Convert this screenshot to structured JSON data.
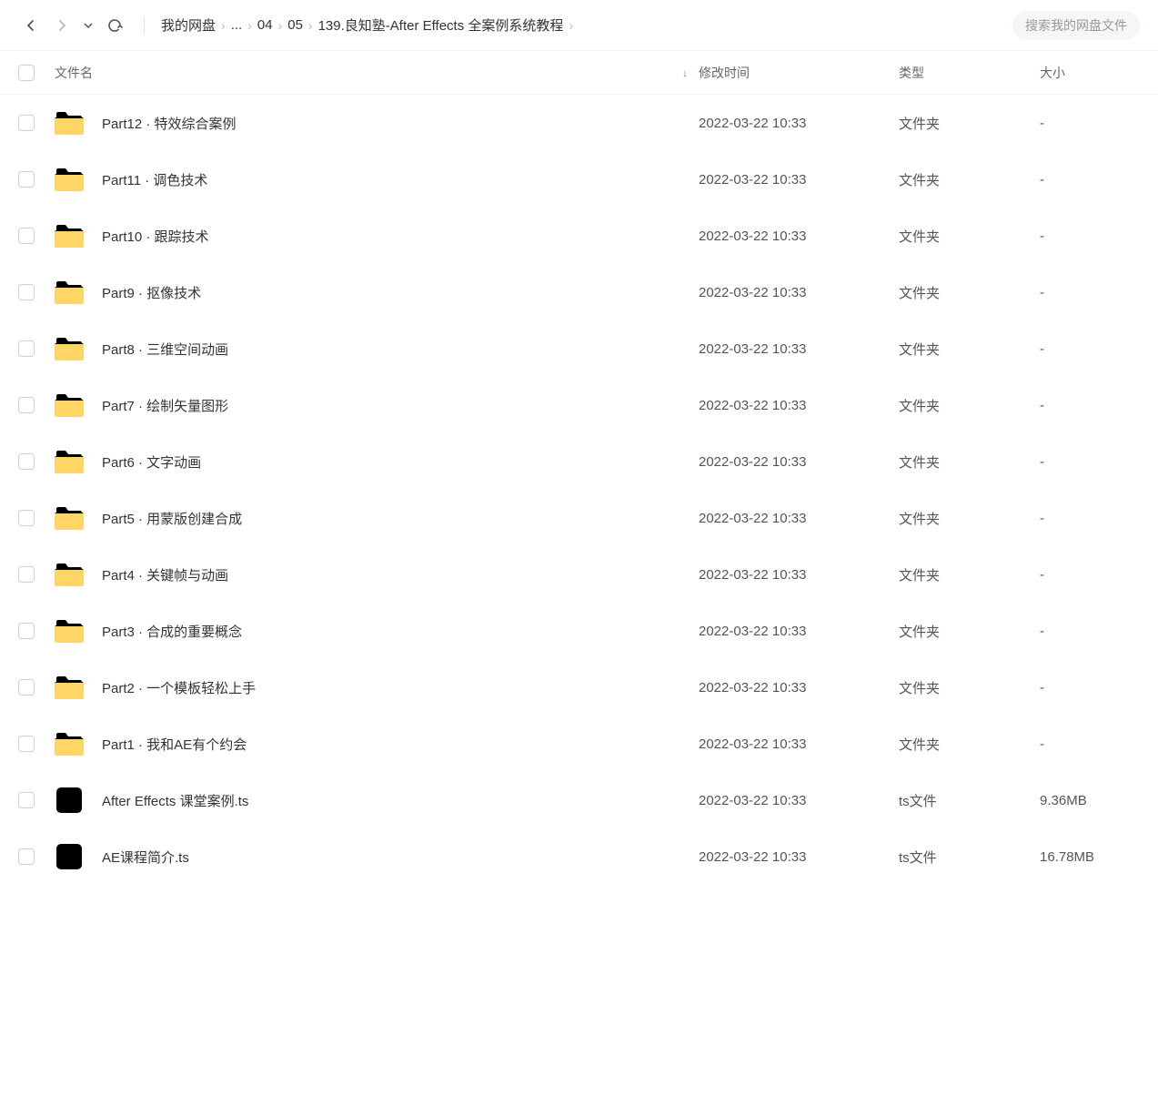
{
  "toolbar": {
    "breadcrumb": [
      "我的网盘",
      "...",
      "04",
      "05",
      "139.良知塾-After Effects 全案例系统教程"
    ]
  },
  "search": {
    "placeholder": "搜索我的网盘文件"
  },
  "columns": {
    "name": "文件名",
    "date": "修改时间",
    "type": "类型",
    "size": "大小"
  },
  "rows": [
    {
      "icon": "folder",
      "name": "Part12 · 特效综合案例",
      "date": "2022-03-22 10:33",
      "type": "文件夹",
      "size": "-"
    },
    {
      "icon": "folder",
      "name": "Part11 · 调色技术",
      "date": "2022-03-22 10:33",
      "type": "文件夹",
      "size": "-"
    },
    {
      "icon": "folder",
      "name": "Part10 · 跟踪技术",
      "date": "2022-03-22 10:33",
      "type": "文件夹",
      "size": "-"
    },
    {
      "icon": "folder",
      "name": "Part9 · 抠像技术",
      "date": "2022-03-22 10:33",
      "type": "文件夹",
      "size": "-"
    },
    {
      "icon": "folder",
      "name": "Part8 · 三维空间动画",
      "date": "2022-03-22 10:33",
      "type": "文件夹",
      "size": "-"
    },
    {
      "icon": "folder",
      "name": "Part7 · 绘制矢量图形",
      "date": "2022-03-22 10:33",
      "type": "文件夹",
      "size": "-"
    },
    {
      "icon": "folder",
      "name": "Part6 · 文字动画",
      "date": "2022-03-22 10:33",
      "type": "文件夹",
      "size": "-"
    },
    {
      "icon": "folder",
      "name": "Part5 · 用蒙版创建合成",
      "date": "2022-03-22 10:33",
      "type": "文件夹",
      "size": "-"
    },
    {
      "icon": "folder",
      "name": "Part4 · 关键帧与动画",
      "date": "2022-03-22 10:33",
      "type": "文件夹",
      "size": "-"
    },
    {
      "icon": "folder",
      "name": "Part3 · 合成的重要概念",
      "date": "2022-03-22 10:33",
      "type": "文件夹",
      "size": "-"
    },
    {
      "icon": "folder",
      "name": "Part2 · 一个模板轻松上手",
      "date": "2022-03-22 10:33",
      "type": "文件夹",
      "size": "-"
    },
    {
      "icon": "folder",
      "name": "Part1 · 我和AE有个约会",
      "date": "2022-03-22 10:33",
      "type": "文件夹",
      "size": "-"
    },
    {
      "icon": "video",
      "name": "After Effects 课堂案例.ts",
      "date": "2022-03-22 10:33",
      "type": "ts文件",
      "size": "9.36MB"
    },
    {
      "icon": "video",
      "name": "AE课程简介.ts",
      "date": "2022-03-22 10:33",
      "type": "ts文件",
      "size": "16.78MB"
    }
  ]
}
